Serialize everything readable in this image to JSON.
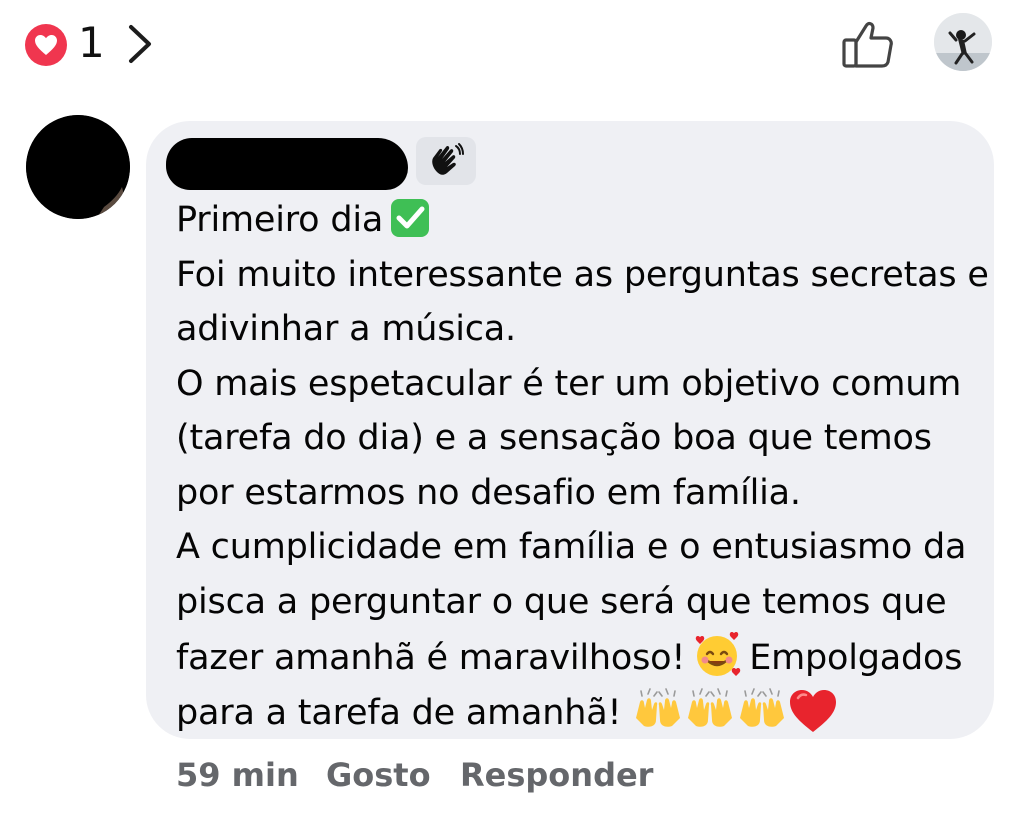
{
  "reactions": {
    "icon": "heart-reaction-icon",
    "count": "1",
    "color": "#f0364f"
  },
  "header": {
    "chevron_icon": "chevron-right-icon",
    "like_icon": "thumbs-up-icon",
    "viewer_avatar": "avatar"
  },
  "comment": {
    "author_name": "",
    "author_badge_icon": "waving-hand-icon",
    "lines": [
      "Primeiro dia",
      "Foi muito interessante as perguntas secretas e",
      "adivinhar a música.",
      "O mais espetacular é ter um objetivo comum",
      "(tarefa do dia) e a sensação boa que temos",
      "por estarmos no desafio em família.",
      "A cumplicidade em família e o entusiasmo da",
      "pisca a perguntar o que será que temos que",
      "fazer amanhã é maravilhoso!",
      "Empolgados",
      "para a tarefa de amanhã!"
    ],
    "emojis": {
      "check": "check-mark-button-emoji",
      "hearts_face": "smiling-face-with-hearts-emoji",
      "raised_hands": "raising-hands-emoji",
      "red_heart": "red-heart-emoji"
    },
    "bubble_color": "#eff0f4"
  },
  "actions": {
    "time": "59 min",
    "like_label": "Gosto",
    "reply_label": "Responder",
    "color": "#65676b"
  }
}
